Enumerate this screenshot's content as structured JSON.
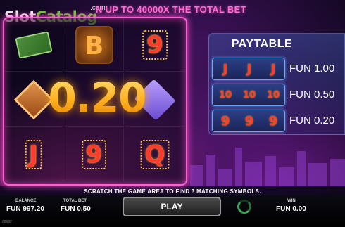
{
  "watermark": {
    "brand_part1": "Slot",
    "brand_part2": "Catalog",
    "brand_suffix": ".com"
  },
  "headline": "N UP TO 40000X THE TOTAL BET",
  "grid": {
    "rows": [
      [
        {
          "symbol": "cash-stack"
        },
        {
          "symbol": "coin-b",
          "glyph": "B"
        },
        {
          "symbol": "digit",
          "glyph": "9"
        }
      ],
      [
        {
          "symbol": "diamond-token"
        },
        {
          "symbol": "hidden"
        },
        {
          "symbol": "gem"
        }
      ],
      [
        {
          "symbol": "digit",
          "glyph": "J"
        },
        {
          "symbol": "digit",
          "glyph": "9"
        },
        {
          "symbol": "digit",
          "glyph": "Q"
        }
      ]
    ],
    "revealed_prize": "0.20"
  },
  "paytable": {
    "title": "PAYTABLE",
    "rows": [
      {
        "glyphs": [
          "J",
          "J",
          "J"
        ],
        "prize": "FUN 1.00"
      },
      {
        "glyphs": [
          "10",
          "10",
          "10"
        ],
        "prize": "FUN 0.50"
      },
      {
        "glyphs": [
          "9",
          "9",
          "9"
        ],
        "prize": "FUN 0.20"
      }
    ]
  },
  "instruction": "SCRATCH THE GAME AREA TO FIND 3 MATCHING SYMBOLS.",
  "footer": {
    "balance_label": "BALANCE",
    "balance_value": "FUN 997.20",
    "total_bet_label": "TOTAL BET",
    "total_bet_value": "FUN 0.50",
    "play_label": "PLAY",
    "win_label": "WIN",
    "win_value": "FUN 0.00",
    "build_id": "88692"
  },
  "colors": {
    "frame": "#ff5fd0",
    "prize_gold": "#ffc63a",
    "accent_green": "#6cc832"
  }
}
